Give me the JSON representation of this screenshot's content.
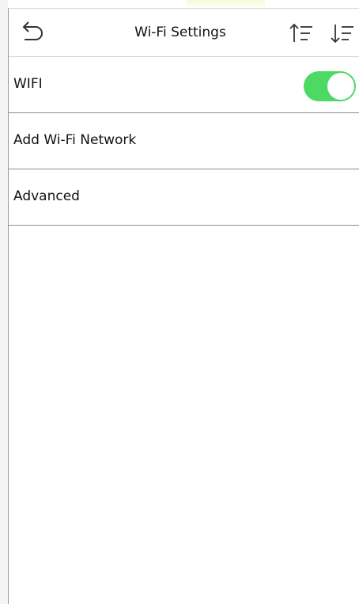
{
  "header": {
    "title": "Wi-Fi Settings",
    "back_icon": "back-arrow-icon",
    "sort_ascending_icon": "sort-ascending-icon",
    "sort_descending_icon": "sort-descending-icon"
  },
  "settings": {
    "items": [
      {
        "label": "WIFI",
        "control": "toggle",
        "value": true
      },
      {
        "label": "Add Wi-Fi Network"
      },
      {
        "label": "Advanced"
      }
    ]
  },
  "colors": {
    "toggle_on": "#4cd964",
    "divider": "#8c8c8c",
    "text": "#111111",
    "background": "#ffffff"
  }
}
